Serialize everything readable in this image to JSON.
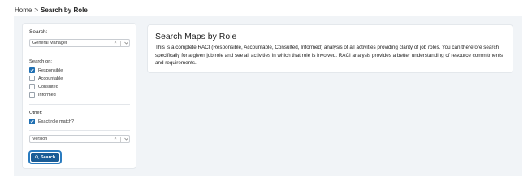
{
  "breadcrumb": {
    "home": "Home",
    "separator": ">",
    "current": "Search by Role"
  },
  "search": {
    "label": "Search:",
    "role_value": "General Manager",
    "clear_glyph": "×"
  },
  "search_on": {
    "label": "Search on:",
    "options": [
      {
        "label": "Responsible",
        "checked": true
      },
      {
        "label": "Accountable",
        "checked": false
      },
      {
        "label": "Consulted",
        "checked": false
      },
      {
        "label": "Informed",
        "checked": false
      }
    ]
  },
  "other": {
    "label": "Other:",
    "exact_match_label": "Exact role match?",
    "exact_match_checked": true,
    "version_value": "Version"
  },
  "search_button": {
    "label": "Search",
    "icon": "search-icon"
  },
  "info": {
    "title": "Search Maps by Role",
    "description": "This is a complete RACI (Responsible, Accountable, Consulted, Informed) analysis of all activities providing clarity of job roles. You can therefore search specifically for a given job role and see all activities in which that role is involved. RACI analysis provides a better understanding of resource commitments and requirements."
  },
  "colors": {
    "accent": "#1a5c96",
    "focus_ring": "#2a7bbf",
    "checkbox": "#1f6fb2",
    "panel_bg": "#f1f4f7"
  }
}
